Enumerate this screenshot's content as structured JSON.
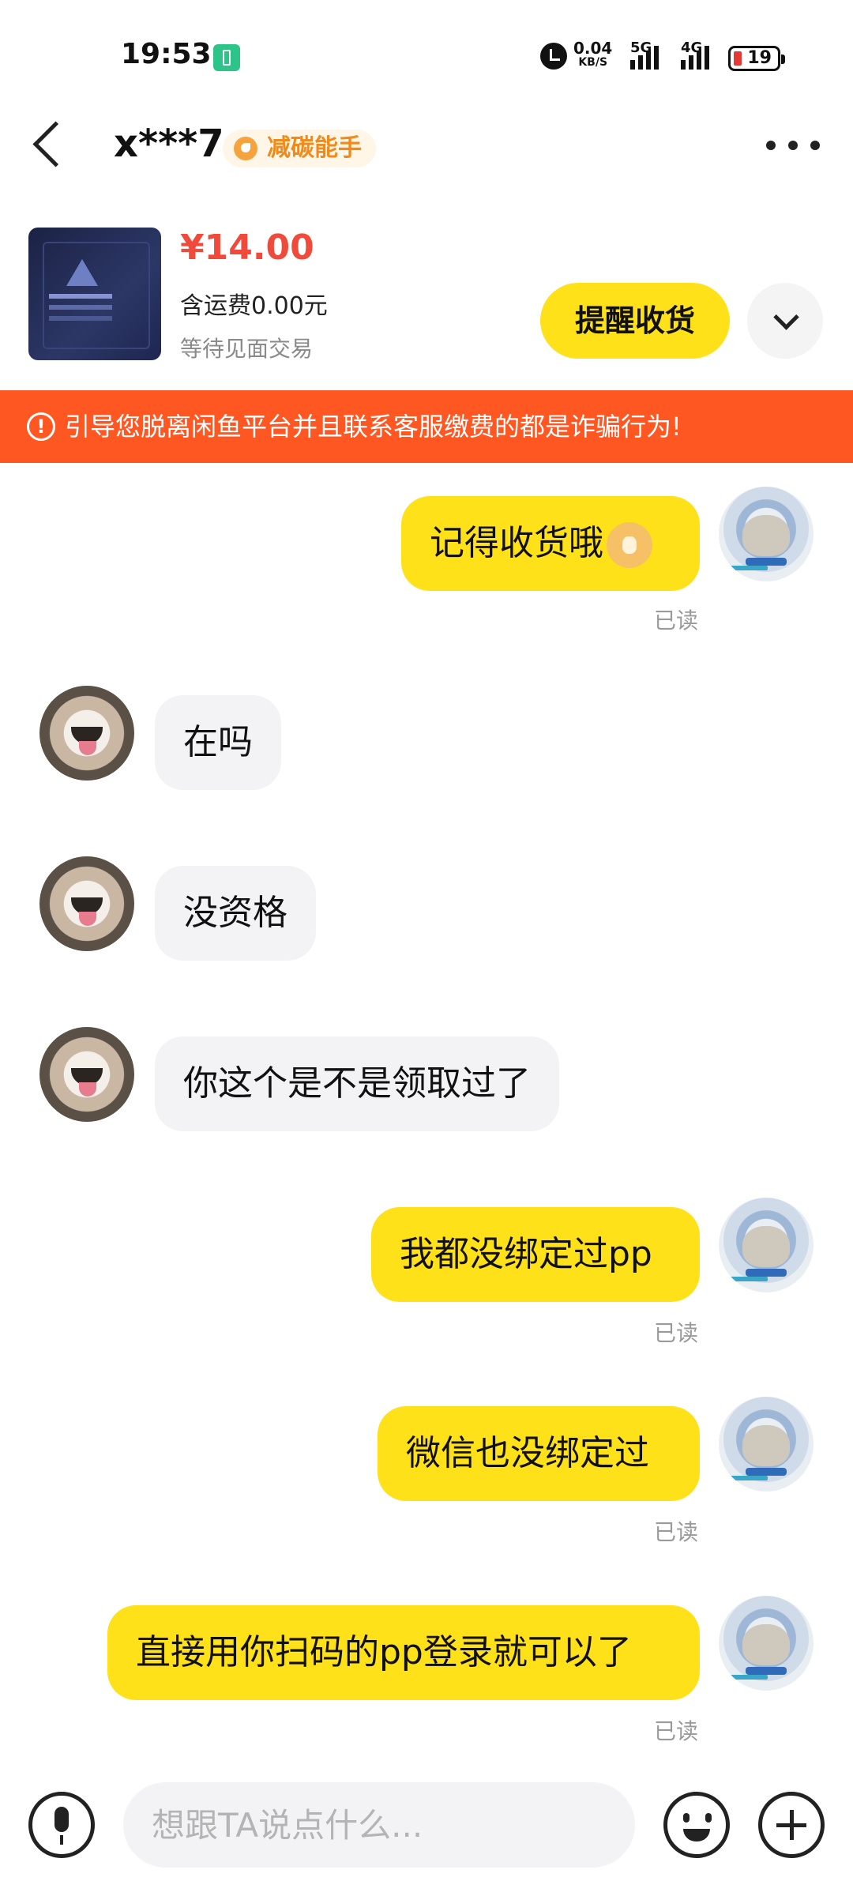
{
  "status_bar": {
    "time": "19:53",
    "net_speed_value": "0.04",
    "net_speed_unit": "KB/S",
    "signal1_label": "5G",
    "signal2_label": "4G",
    "battery_level": "19",
    "icons": [
      "charging-icon",
      "alarm-icon",
      "signal-icon",
      "battery-icon"
    ]
  },
  "header": {
    "username": "x***7",
    "badge_label": "减碳能手",
    "icons": [
      "back-icon",
      "more-icon"
    ]
  },
  "product": {
    "price": "¥14.00",
    "shipping": "含运费0.00元",
    "status": "等待见面交易",
    "remind_button": "提醒收货"
  },
  "warning": {
    "text": "引导您脱离闲鱼平台并且联系客服缴费的都是诈骗行为!",
    "icon": "!"
  },
  "messages": [
    {
      "from": "me",
      "text": "记得收货哦",
      "has_emoji": true,
      "status": "已读"
    },
    {
      "from": "them",
      "text": "在吗"
    },
    {
      "from": "them",
      "text": "没资格"
    },
    {
      "from": "them",
      "text": "你这个是不是领取过了"
    },
    {
      "from": "me",
      "text": "我都没绑定过pp",
      "status": "已读"
    },
    {
      "from": "me",
      "text": "微信也没绑定过",
      "status": "已读"
    },
    {
      "from": "me",
      "text": "直接用你扫码的pp登录就可以了",
      "status": "已读"
    }
  ],
  "input": {
    "placeholder": "想跟TA说点什么...",
    "value": ""
  },
  "colors": {
    "accent_yellow": "#ffe11a",
    "price_red": "#ef4a3a",
    "warning_orange": "#ff5722",
    "badge_orange": "#f08a1a"
  }
}
